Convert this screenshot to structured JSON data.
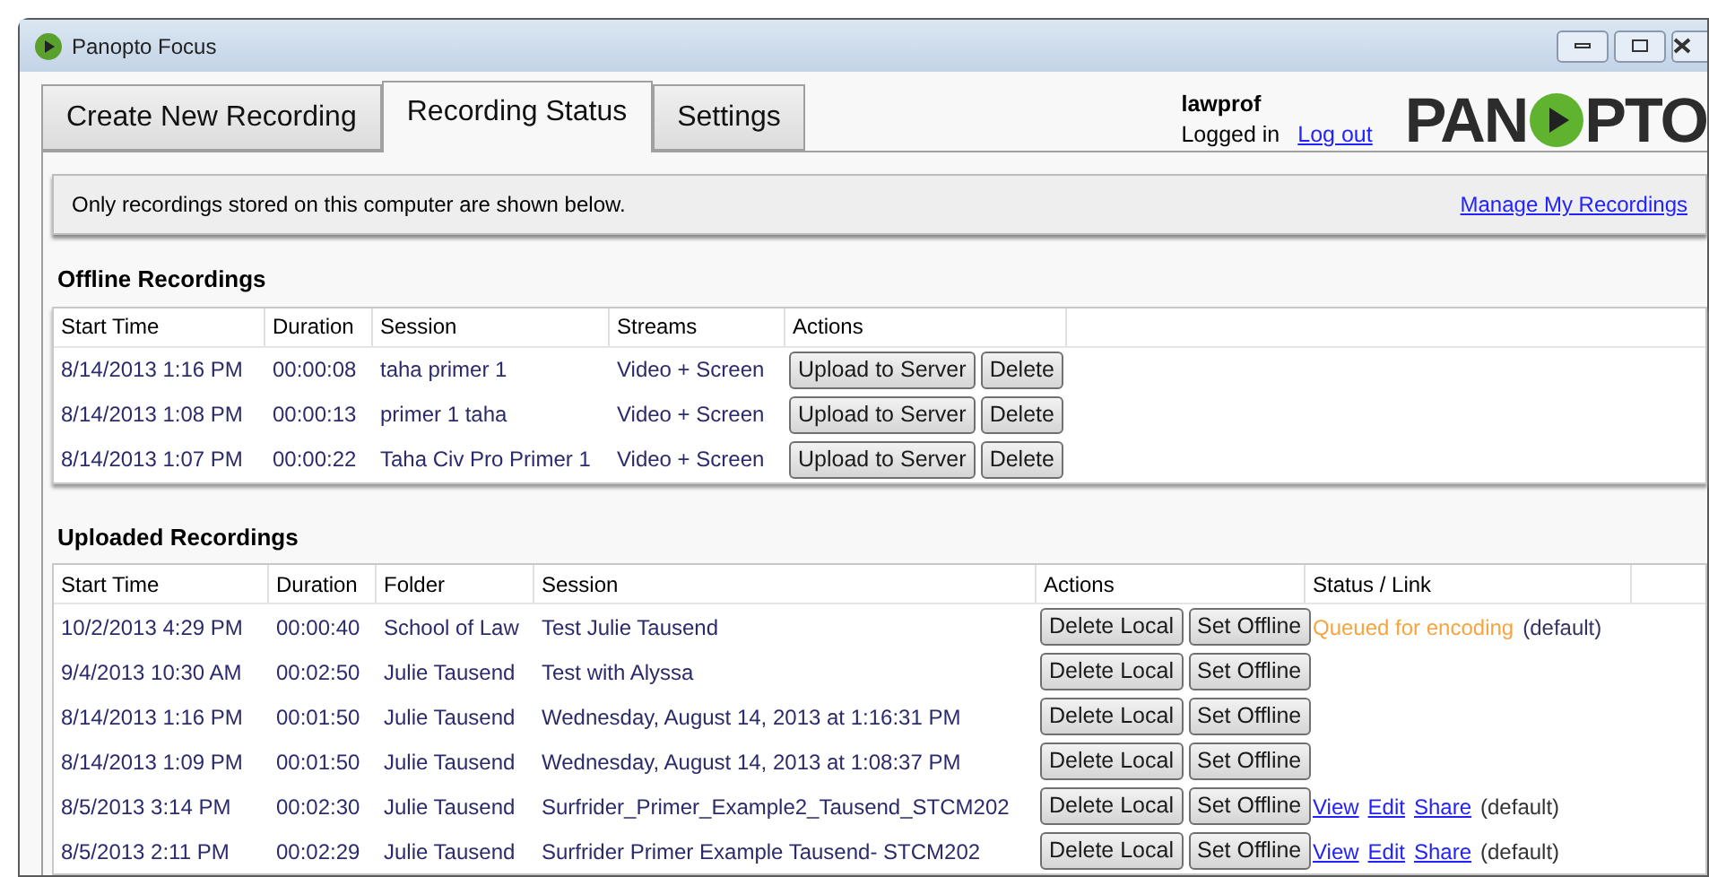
{
  "window": {
    "title": "Panopto Focus"
  },
  "tabs": [
    {
      "label": "Create New Recording",
      "selected": false
    },
    {
      "label": "Recording Status",
      "selected": true
    },
    {
      "label": "Settings",
      "selected": false
    }
  ],
  "user": {
    "name": "lawprof",
    "status": "Logged in",
    "logout": "Log out"
  },
  "logo": {
    "left": "PAN",
    "right": "PTO"
  },
  "notice": {
    "text": "Only recordings stored on this computer are shown below.",
    "link": "Manage My Recordings"
  },
  "offline": {
    "title": "Offline Recordings",
    "columns": [
      "Start Time",
      "Duration",
      "Session",
      "Streams",
      "Actions"
    ],
    "rows": [
      {
        "start": "8/14/2013 1:16 PM",
        "duration": "00:00:08",
        "session": "taha primer 1",
        "streams": "Video + Screen",
        "actions": [
          "Upload to Server",
          "Delete"
        ]
      },
      {
        "start": "8/14/2013 1:08 PM",
        "duration": "00:00:13",
        "session": "primer 1 taha",
        "streams": "Video + Screen",
        "actions": [
          "Upload to Server",
          "Delete"
        ]
      },
      {
        "start": "8/14/2013 1:07 PM",
        "duration": "00:00:22",
        "session": "Taha Civ Pro Primer 1",
        "streams": "Video + Screen",
        "actions": [
          "Upload to Server",
          "Delete"
        ]
      }
    ]
  },
  "uploaded": {
    "title": "Uploaded Recordings",
    "columns": [
      "Start Time",
      "Duration",
      "Folder",
      "Session",
      "Actions",
      "Status / Link"
    ],
    "rows": [
      {
        "start": "10/2/2013 4:29 PM",
        "duration": "00:00:40",
        "folder": "School of Law",
        "session": "Test Julie Tausend",
        "actions": [
          "Delete Local",
          "Set Offline"
        ],
        "status": {
          "kind": "queued",
          "text": "Queued for encoding",
          "note": "(default)"
        }
      },
      {
        "start": "9/4/2013 10:30 AM",
        "duration": "00:02:50",
        "folder": "Julie Tausend",
        "session": "Test with Alyssa",
        "actions": [
          "Delete Local",
          "Set Offline"
        ]
      },
      {
        "start": "8/14/2013 1:16 PM",
        "duration": "00:01:50",
        "folder": "Julie Tausend",
        "session": "Wednesday, August 14, 2013 at 1:16:31 PM",
        "actions": [
          "Delete Local",
          "Set Offline"
        ]
      },
      {
        "start": "8/14/2013 1:09 PM",
        "duration": "00:01:50",
        "folder": "Julie Tausend",
        "session": "Wednesday, August 14, 2013 at 1:08:37 PM",
        "actions": [
          "Delete Local",
          "Set Offline"
        ]
      },
      {
        "start": "8/5/2013 3:14 PM",
        "duration": "00:02:30",
        "folder": "Julie Tausend",
        "session": "Surfrider_Primer_Example2_Tausend_STCM202",
        "actions": [
          "Delete Local",
          "Set Offline"
        ],
        "status": {
          "kind": "links",
          "links": [
            "View",
            "Edit",
            "Share"
          ],
          "note": "(default)"
        }
      },
      {
        "start": "8/5/2013 2:11 PM",
        "duration": "00:02:29",
        "folder": "Julie Tausend",
        "session": "Surfrider Primer Example Tausend- STCM202",
        "actions": [
          "Delete Local",
          "Set Offline"
        ],
        "status": {
          "kind": "links",
          "links": [
            "View",
            "Edit",
            "Share"
          ],
          "note": "(default)"
        }
      }
    ]
  }
}
